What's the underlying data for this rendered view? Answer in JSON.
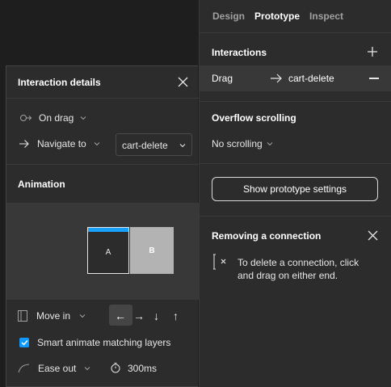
{
  "right_panel": {
    "tabs": [
      {
        "label": "Design"
      },
      {
        "label": "Prototype"
      },
      {
        "label": "Inspect"
      }
    ],
    "interactions": {
      "title": "Interactions",
      "rows": [
        {
          "trigger": "Drag",
          "destination": "cart-delete"
        }
      ]
    },
    "overflow": {
      "title": "Overflow scrolling",
      "value": "No scrolling"
    },
    "settings_button": "Show prototype settings",
    "removing": {
      "title": "Removing a connection",
      "text_line1": "To delete a connection, click",
      "text_line2": "and drag on either end."
    }
  },
  "details": {
    "title": "Interaction details",
    "trigger": "On drag",
    "action": "Navigate to",
    "destination": "cart-delete",
    "animation_title": "Animation",
    "preview": {
      "frame_a": "A",
      "frame_b": "B"
    },
    "transition": "Move in",
    "directions": [
      "←",
      "→",
      "↓",
      "↑"
    ],
    "selected_direction": "←",
    "smart_animate": {
      "label": "Smart animate matching layers",
      "checked": true
    },
    "easing": "Ease out",
    "duration": "300ms"
  },
  "colors": {
    "accent": "#0d99ff",
    "frame_bar": "#18a0fb",
    "panel_bg": "#2c2c2c",
    "canvas_bg": "#1e1e1e"
  }
}
